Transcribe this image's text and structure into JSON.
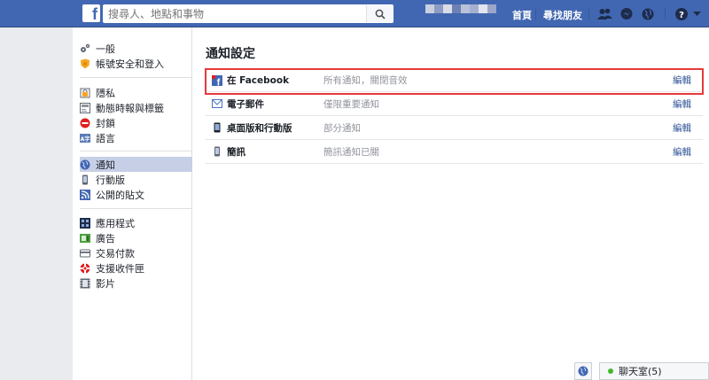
{
  "topbar": {
    "logo": "f",
    "search_placeholder": "搜尋人、地點和事物",
    "nav": {
      "home": "首頁",
      "find_friends": "尋找朋友"
    }
  },
  "sidebar": {
    "group1": [
      {
        "label": "一般",
        "icon": "gears-icon"
      },
      {
        "label": "帳號安全和登入",
        "icon": "shield-icon"
      }
    ],
    "group2": [
      {
        "label": "隱私",
        "icon": "lock-icon"
      },
      {
        "label": "動態時報與標籤",
        "icon": "timeline-icon"
      },
      {
        "label": "封鎖",
        "icon": "block-icon"
      },
      {
        "label": "語言",
        "icon": "language-icon"
      }
    ],
    "group3": [
      {
        "label": "通知",
        "icon": "globe-icon",
        "active": true
      },
      {
        "label": "行動版",
        "icon": "mobile-icon"
      },
      {
        "label": "公開的貼文",
        "icon": "rss-icon"
      }
    ],
    "group4": [
      {
        "label": "應用程式",
        "icon": "apps-icon"
      },
      {
        "label": "廣告",
        "icon": "ads-icon"
      },
      {
        "label": "交易付款",
        "icon": "payments-icon"
      },
      {
        "label": "支援收件匣",
        "icon": "support-icon"
      },
      {
        "label": "影片",
        "icon": "video-icon"
      }
    ]
  },
  "main": {
    "title": "通知設定",
    "rows": [
      {
        "label": "在 Facebook",
        "value": "所有通知，關閉音效",
        "edit": "編輯",
        "icon": "facebook-icon"
      },
      {
        "label": "電子郵件",
        "value": "僅限重要通知",
        "edit": "編輯",
        "icon": "email-icon"
      },
      {
        "label": "桌面版和行動版",
        "value": "部分通知",
        "edit": "編輯",
        "icon": "device-icon"
      },
      {
        "label": "簡訊",
        "value": "簡訊通知已關",
        "edit": "編輯",
        "icon": "sms-icon"
      }
    ]
  },
  "chat": {
    "label": "聊天室(5)"
  },
  "colors": {
    "brand": "#4267b2",
    "link": "#365899",
    "highlight": "#e8393a",
    "active": "#c6cfe6",
    "online": "#42b72a"
  }
}
